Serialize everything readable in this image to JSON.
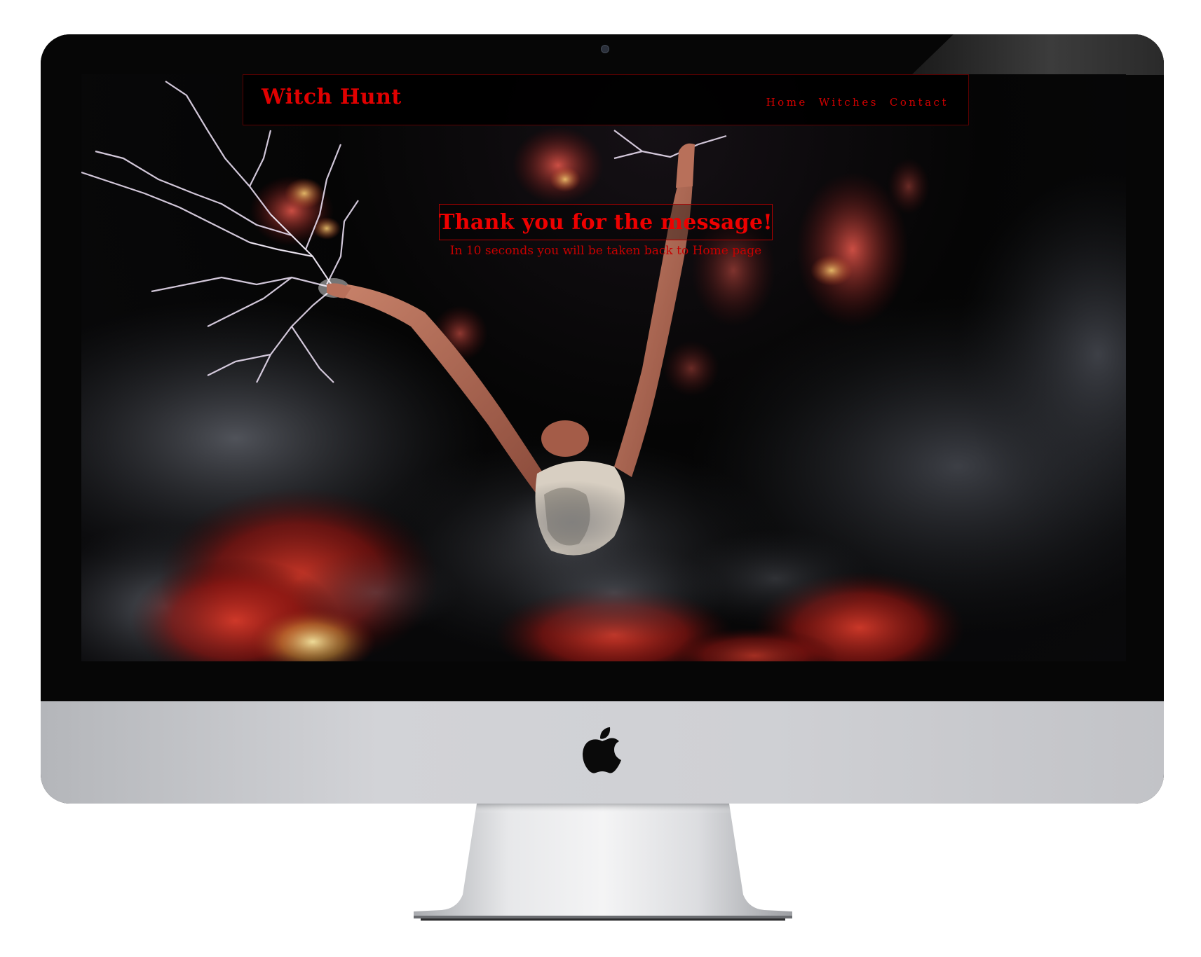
{
  "site": {
    "brand": "Witch Hunt",
    "nav": [
      {
        "label": "Home"
      },
      {
        "label": "Witches"
      },
      {
        "label": "Contact"
      }
    ]
  },
  "main": {
    "heading": "Thank you for the message!",
    "redirect_text": "In 10 seconds you will be taken back to Home page"
  },
  "colors": {
    "accent": "#e00000",
    "background": "#050505"
  },
  "icons": {
    "device_logo": "apple-logo-icon"
  }
}
